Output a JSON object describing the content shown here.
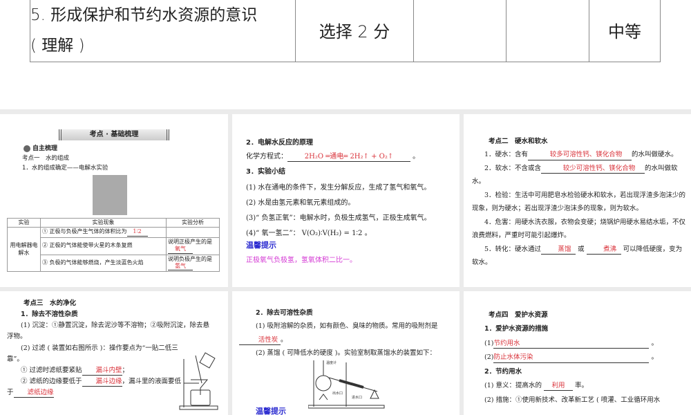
{
  "top_table": {
    "col1": "5. 形成保护和节约水资源的意识",
    "col1b": "( 理解 )",
    "col2": "选择  2  分",
    "col3": "",
    "col4": "",
    "col5": "中等"
  },
  "slide1": {
    "banner": "考点 · 基础梳理",
    "section": "自主梳理",
    "heading": "考点一　水的组成",
    "sub": "1．水的组成确定——电解水实验",
    "table": {
      "headers": [
        "实验",
        "实验现象",
        "实验分析"
      ],
      "row_label": "用电解器电解水",
      "rows": [
        {
          "phen": "① 正极与负极产生气体的体积比为",
          "ans": "1∶2",
          "analysis": "",
          "ans2": ""
        },
        {
          "phen": "② 正极的气体能使带火星的木条复燃",
          "ans": "",
          "analysis": "说明正极产生的是",
          "ans2": "氧气"
        },
        {
          "phen": "③ 负极的气体能够燃烧，产生淡蓝色火焰",
          "ans": "",
          "analysis": "说明负极产生的是",
          "ans2": "氢气"
        }
      ]
    }
  },
  "slide2": {
    "h2": "2．电解水反应的原理",
    "eq_label": "化学方程式：",
    "eq_ans": "2H₂O ═通电═ 2H₂↑ + O₂↑",
    "h3": "3．实验小结",
    "items": [
      "(1) 水在通电的条件下，发生分解反应，生成了氢气和氧气。",
      "(2) 水是由氢元素和氧元素组成的。",
      "(3)“ 负氢正氧”：电解水时，负极生成氢气，正极生成氧气。",
      "(4)“ 氧一氢二”： V(O₂)∶V(H₂) = 1∶2 。"
    ],
    "tip": "温馨提示",
    "tip_text": "正极氧气负极氢，氢氧体积二比一。"
  },
  "slide3": {
    "heading": "考点二　硬水和软水",
    "l1a": "1．硬水：含有",
    "l1ans": "较多可溶性钙、镁化合物",
    "l1b": "的水叫做硬水。",
    "l2a": "2．软水：不含或含",
    "l2ans": "较少可溶性钙、镁化合物",
    "l2b": "的水叫做软水。",
    "l3": "3．检验：生活中可用肥皂水检验硬水和软水，若出现浮渣多泡沫少的现象，则为硬水；若出现浮渣少泡沫多的现象，则为软水。",
    "l4": "4．危害：用硬水洗衣服，衣物会变硬；烧锅炉用硬水易结水垢，不仅浪费燃料，严重时可能引起爆炸。",
    "l5a": "5．转化：硬水通过",
    "l5ans1": "蒸馏",
    "l5or": "或",
    "l5ans2": "煮沸",
    "l5b": "可以降低硬度，变为软水。"
  },
  "slide4": {
    "heading": "考点三　水的净化",
    "h1": "1．除去不溶性杂质",
    "p1": "(1) 沉淀：①静置沉淀，除去泥沙等不溶物；②吸附沉淀，除去悬浮物。",
    "p2": "(2) 过滤 ( 装置如右图所示 )：操作要点为“一贴二低三靠”。",
    "p3a": "① 过滤时滤纸要紧贴",
    "p3ans": "漏斗内壁",
    "p3b": "；",
    "p4a": "② 滤纸的边缘要低于",
    "p4ans": "漏斗边缘",
    "p4b": "，漏斗里的液面要低于",
    "p4ans2": "滤纸边缘"
  },
  "slide5": {
    "h2": "2．除去可溶性杂质",
    "p1a": "(1) 吸附溶解的杂质，如有颜色、臭味的物质。常用的吸附剂是",
    "p1ans": "活性炭",
    "p1b": "。",
    "p2": "(2) 蒸馏 ( 可降低水的硬度 )。实验室制取蒸馏水的装置如下：",
    "labels": {
      "thermo": "温度计",
      "out": "出水口",
      "in": "进水口"
    },
    "tip": "温馨提示"
  },
  "slide6": {
    "heading": "考点四　爱护水资源",
    "h1": "1．爱护水资源的措施",
    "m1": "(1)",
    "m1ans": "节约用水",
    "m2": "(2)",
    "m2ans": "防止水体污染",
    "h2": "2．节约用水",
    "s1a": "(1) 意义：提高水的",
    "s1ans": "利用",
    "s1b": "率。",
    "s2": "(2) 措施：①使用新技术、改革新工艺 ( 喷灌、工业循环用水"
  }
}
